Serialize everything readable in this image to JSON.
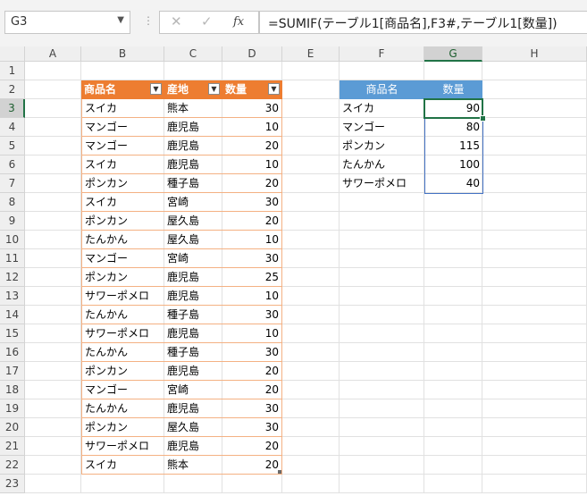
{
  "formula_bar": {
    "name_box": "G3",
    "cancel_symbol": "✕",
    "enter_symbol": "✓",
    "fx_symbol": "fx",
    "formula": "=SUMIF(テーブル1[商品名],F3#,テーブル1[数量])"
  },
  "columns": [
    "A",
    "B",
    "C",
    "D",
    "E",
    "F",
    "G",
    "H"
  ],
  "rows": [
    "1",
    "2",
    "3",
    "4",
    "5",
    "6",
    "7",
    "8",
    "9",
    "10",
    "11",
    "12",
    "13",
    "14",
    "15",
    "16",
    "17",
    "18",
    "19",
    "20",
    "21",
    "22",
    "23"
  ],
  "selected_cell": "G3",
  "table": {
    "headers": [
      "商品名",
      "産地",
      "数量"
    ],
    "rows": [
      [
        "スイカ",
        "熊本",
        "30"
      ],
      [
        "マンゴー",
        "鹿児島",
        "10"
      ],
      [
        "マンゴー",
        "鹿児島",
        "20"
      ],
      [
        "スイカ",
        "鹿児島",
        "10"
      ],
      [
        "ポンカン",
        "種子島",
        "20"
      ],
      [
        "スイカ",
        "宮崎",
        "30"
      ],
      [
        "ポンカン",
        "屋久島",
        "20"
      ],
      [
        "たんかん",
        "屋久島",
        "10"
      ],
      [
        "マンゴー",
        "宮崎",
        "30"
      ],
      [
        "ポンカン",
        "鹿児島",
        "25"
      ],
      [
        "サワーポメロ",
        "鹿児島",
        "10"
      ],
      [
        "たんかん",
        "種子島",
        "30"
      ],
      [
        "サワーポメロ",
        "鹿児島",
        "10"
      ],
      [
        "たんかん",
        "種子島",
        "30"
      ],
      [
        "ポンカン",
        "鹿児島",
        "20"
      ],
      [
        "マンゴー",
        "宮崎",
        "20"
      ],
      [
        "たんかん",
        "鹿児島",
        "30"
      ],
      [
        "ポンカン",
        "屋久島",
        "30"
      ],
      [
        "サワーポメロ",
        "鹿児島",
        "20"
      ],
      [
        "スイカ",
        "熊本",
        "20"
      ]
    ]
  },
  "summary": {
    "headers": [
      "商品名",
      "数量"
    ],
    "rows": [
      [
        "スイカ",
        "90"
      ],
      [
        "マンゴー",
        "80"
      ],
      [
        "ポンカン",
        "115"
      ],
      [
        "たんかん",
        "100"
      ],
      [
        "サワーポメロ",
        "40"
      ]
    ]
  },
  "colors": {
    "table_header": "#ed7d31",
    "table_border": "#f4b183",
    "summary_header": "#5b9bd5",
    "selection": "#217346",
    "spill_border": "#4472c4"
  }
}
